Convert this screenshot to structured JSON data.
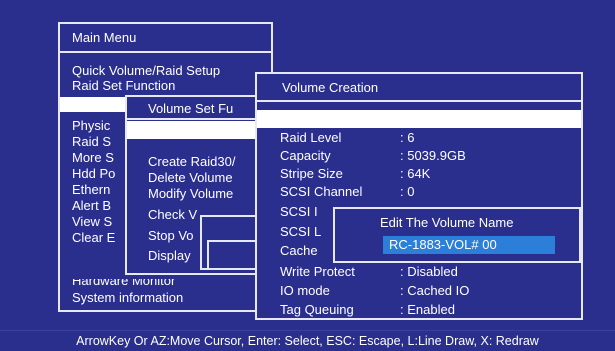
{
  "main_menu": {
    "title": "Main Menu",
    "items": [
      "Quick Volume/Raid Setup",
      "Raid Set Function",
      "",
      "Physic",
      "Raid S",
      "More S",
      "Hdd Po",
      "Ethern",
      "Alert B",
      "View S",
      "Clear E",
      "Hardware Monitor",
      "System information"
    ]
  },
  "volume_set_function": {
    "title": "Volume Set Fu",
    "items": [
      "Create Raid30/",
      "Delete Volume",
      "Modify Volume",
      "Check V",
      "Stop Vo",
      "Display"
    ]
  },
  "volume_creation": {
    "title": "Volume Creation",
    "rows": [
      {
        "label": "Raid Level",
        "value": ": 6"
      },
      {
        "label": "Capacity",
        "value": ": 5039.9GB"
      },
      {
        "label": "Stripe Size",
        "value": ": 64K"
      },
      {
        "label": "SCSI Channel",
        "value": ": 0"
      },
      {
        "label": "SCSI I",
        "value": ""
      },
      {
        "label": "SCSI L",
        "value": ""
      },
      {
        "label": "Cache",
        "value": ""
      },
      {
        "label": "Write Protect",
        "value": ": Disabled"
      },
      {
        "label": "IO mode",
        "value": ": Cached IO"
      },
      {
        "label": "Tag Queuing",
        "value": ": Enabled"
      }
    ]
  },
  "edit_dialog": {
    "title": "Edit The Volume Name",
    "value": "RC-1883-VOL# 00"
  },
  "status_bar": "ArrowKey Or AZ:Move Cursor, Enter: Select, ESC: Escape, L:Line Draw, X: Redraw",
  "colors": {
    "background": "#2a2e8c",
    "border": "#e8e8f4",
    "highlight": "#ffffff",
    "field": "#2b7fd8"
  }
}
